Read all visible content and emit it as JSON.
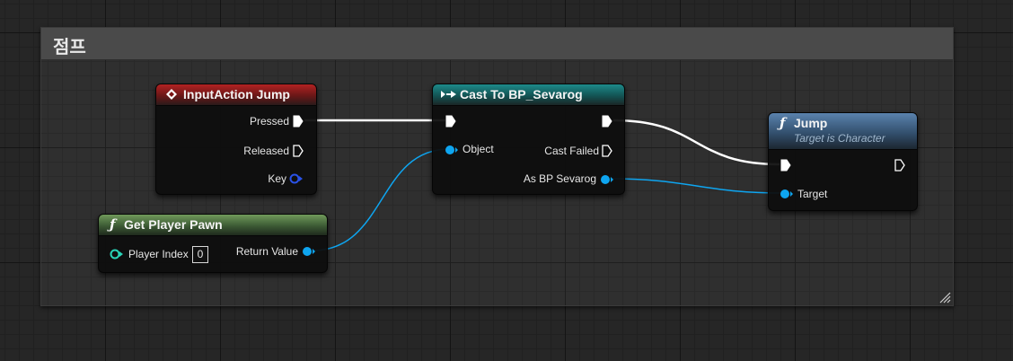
{
  "comment": {
    "title": "점프"
  },
  "nodes": {
    "input_action": {
      "title": "InputAction Jump",
      "pins": {
        "pressed": "Pressed",
        "released": "Released",
        "key": "Key"
      }
    },
    "cast": {
      "title": "Cast To BP_Sevarog",
      "pins": {
        "object": "Object",
        "cast_failed": "Cast Failed",
        "as_bp": "As BP Sevarog"
      }
    },
    "get_pawn": {
      "title": "Get Player Pawn",
      "pins": {
        "player_index": "Player Index",
        "player_index_value": "0",
        "return_value": "Return Value"
      }
    },
    "jump": {
      "title": "Jump",
      "subtitle": "Target is Character",
      "pins": {
        "target": "Target"
      }
    }
  },
  "icons": {
    "input_event": "diamond-event-icon",
    "cast": "cast-arrows-icon",
    "function": "function-f-icon",
    "resize": "resize-grip-icon"
  },
  "colors": {
    "exec_wire": "#ffffff",
    "object_pin": "#0ea5f0",
    "struct_pin": "#2a52e8",
    "int_pin": "#2ad4b8",
    "input_header": "#b22222",
    "cast_header": "#1d8a8a",
    "pure_header": "#709a5a",
    "function_header": "#5a82ad"
  }
}
